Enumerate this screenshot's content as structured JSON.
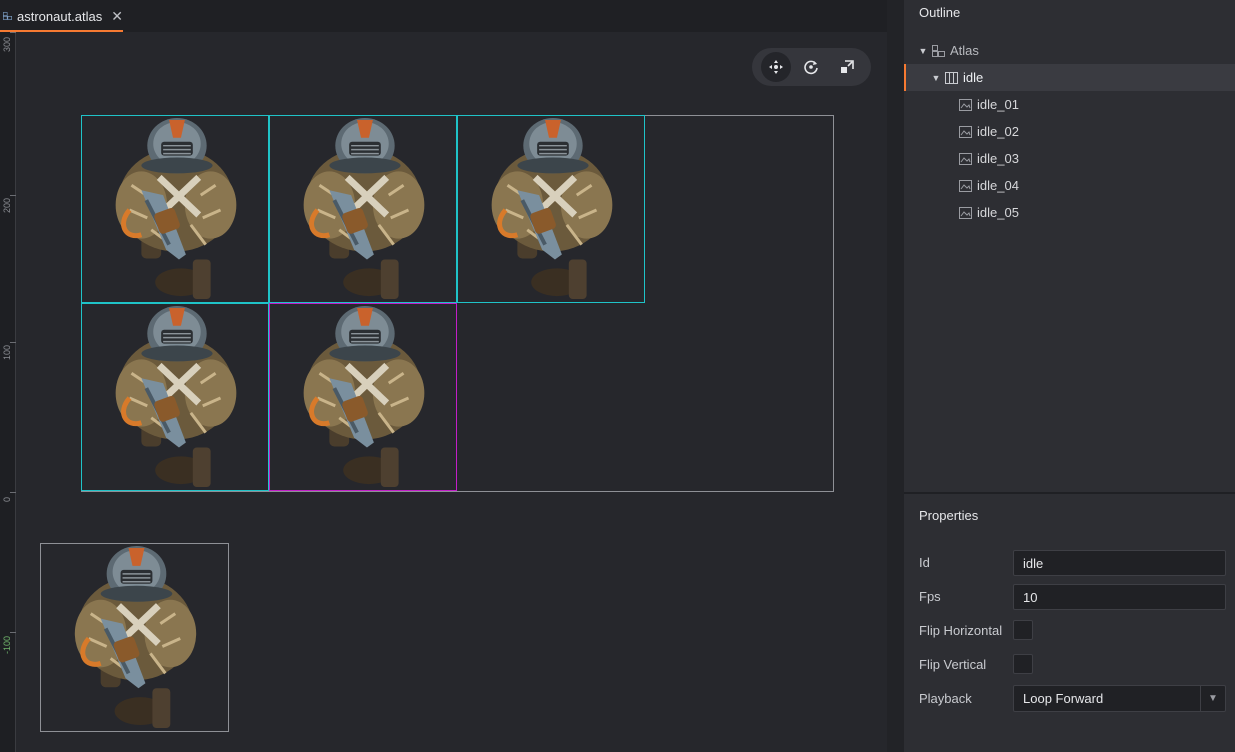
{
  "tab": {
    "title": "astronaut.atlas",
    "close_glyph": "✕",
    "icon": "atlas-icon"
  },
  "ruler": {
    "labels": [
      "300",
      "200",
      "100",
      "0",
      "-100"
    ]
  },
  "toolbar": {
    "tools": [
      "move-tool-icon",
      "rotate-tool-icon",
      "scale-tool-icon"
    ],
    "active": "move"
  },
  "outline": {
    "title": "Outline",
    "root": {
      "label": "Atlas",
      "icon": "atlas-icon",
      "expanded": true
    },
    "animation": {
      "label": "idle",
      "icon": "animation-icon",
      "expanded": true,
      "selected": true
    },
    "images": [
      "idle_01",
      "idle_02",
      "idle_03",
      "idle_04",
      "idle_05"
    ]
  },
  "properties": {
    "title": "Properties",
    "id_label": "Id",
    "id_value": "idle",
    "fps_label": "Fps",
    "fps_value": "10",
    "flip_h_label": "Flip Horizontal",
    "flip_h_checked": false,
    "flip_v_label": "Flip Vertical",
    "flip_v_checked": false,
    "playback_label": "Playback",
    "playback_value": "Loop Forward"
  },
  "colors": {
    "accent": "#f67a32",
    "selection_cyan": "#1fc3c8",
    "selection_magenta": "#c21ec8"
  }
}
